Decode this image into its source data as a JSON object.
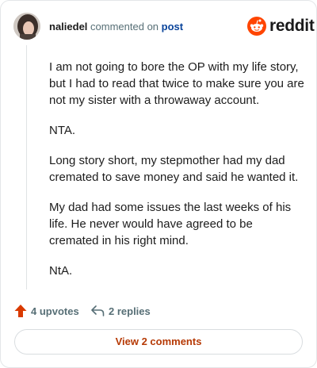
{
  "comment": {
    "username": "naliedel",
    "verb": "commented on",
    "post_link": "post",
    "paragraphs": [
      "I am not going to bore the OP with my life story, but I had to read that twice to make sure you are not my sister with a throwaway account.",
      "NTA.",
      "Long story short, my stepmother had my dad cremated to save money and said he wanted it.",
      "My dad had some issues the last weeks of his life. He never would have agreed to be cremated in his right mind.",
      "NtA."
    ]
  },
  "brand": {
    "name": "reddit",
    "icon": "reddit-logo-icon",
    "color": "#ff4500"
  },
  "actions": {
    "upvotes_label": "4 upvotes",
    "upvote_icon": "upvote-arrow-icon",
    "upvote_color": "#d93a00",
    "replies_label": "2 replies",
    "reply_icon": "reply-arrow-icon"
  },
  "footer": {
    "view_comments_label": "View 2 comments",
    "accent_color": "#b63a06"
  }
}
